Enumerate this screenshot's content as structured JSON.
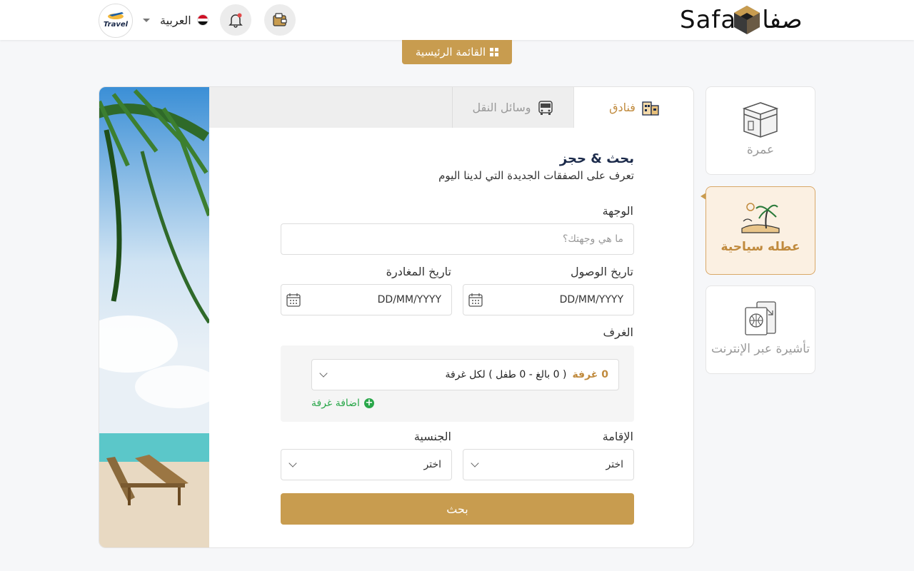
{
  "header": {
    "logo_latin": "Safa",
    "logo_arabic": "صفا",
    "language_label": "العربية",
    "travel_logo_text": "Travel",
    "icons": [
      "wallet-icon",
      "bell-icon",
      "egypt-flag-icon",
      "dropdown-caret-icon"
    ]
  },
  "main_menu": {
    "label": "القائمة الرئيسية",
    "icon": "grid-icon"
  },
  "sidebar": {
    "items": [
      {
        "label": "عمرة",
        "icon": "kaaba-icon",
        "active": false
      },
      {
        "label": "عطله سياحية",
        "icon": "palm-beach-icon",
        "active": true
      },
      {
        "label": "تأشيرة عبر الإنترنت",
        "icon": "passport-visa-icon",
        "active": false
      }
    ]
  },
  "tabs": [
    {
      "label": "فنادق",
      "icon": "hotel-icon",
      "active": true
    },
    {
      "label": "وسائل النقل",
      "icon": "bus-icon",
      "active": false
    }
  ],
  "form": {
    "title": "بحث & حجز",
    "subtitle": "تعرف على الصفقات الجديدة التي لدينا اليوم",
    "destination": {
      "label": "الوجهة",
      "placeholder": "ما هي وجهتك؟"
    },
    "arrival": {
      "label": "تاريخ الوصول",
      "value": "DD/MM/YYYY"
    },
    "departure": {
      "label": "تاريخ المغادرة",
      "value": "DD/MM/YYYY"
    },
    "rooms": {
      "label": "الغرف",
      "count_text": "0 غرفة",
      "detail_text": "( 0 بالغ  -  0 طفل  ) لكل غرفة",
      "add_room": "اضافة غرفة"
    },
    "residence": {
      "label": "الإقامة",
      "value": "اختر"
    },
    "nationality": {
      "label": "الجنسية",
      "value": "اختر"
    },
    "search_button": "بحث"
  },
  "colors": {
    "accent": "#c89c4f",
    "accent_text": "#c08a3d",
    "active_card_bg": "#fbf0e2",
    "green": "#2aa74a",
    "navy": "#1b2a4a"
  }
}
